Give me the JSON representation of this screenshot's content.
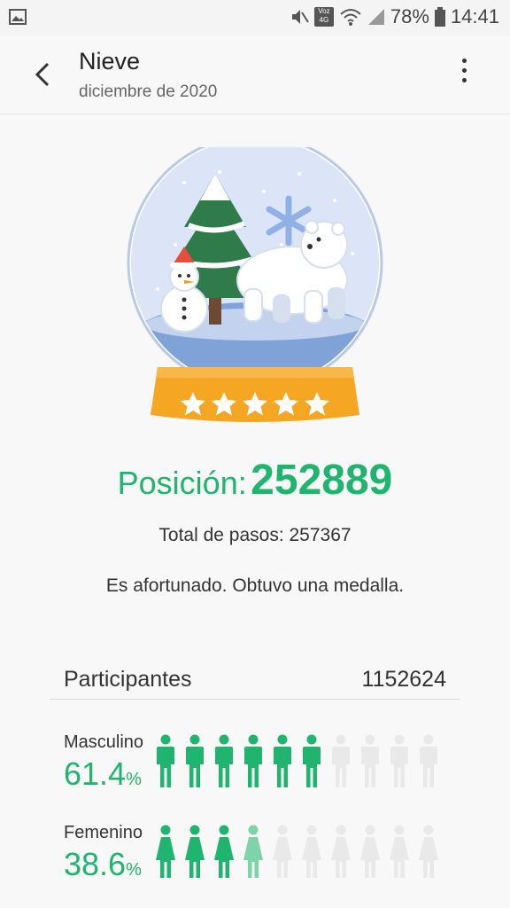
{
  "status_bar": {
    "battery": "78%",
    "time": "14:41",
    "network_badge": "Voz 4G"
  },
  "header": {
    "title": "Nieve",
    "subtitle": "diciembre de 2020"
  },
  "result": {
    "position_label": "Posición:",
    "position_value": "252889",
    "total_steps": "Total de pasos: 257367",
    "message": "Es afortunado. Obtuvo una medalla."
  },
  "participants": {
    "label": "Participantes",
    "value": "1152624"
  },
  "genders": [
    {
      "label": "Masculino",
      "percent": "61.4",
      "percent_sign": "%",
      "share": 0.614
    },
    {
      "label": "Femenino",
      "percent": "38.6",
      "percent_sign": "%",
      "share": 0.386
    }
  ],
  "colors": {
    "accent_green": "#1fb56e",
    "light_green": "#7ed3a8",
    "inactive_figure": "#e9e9e9",
    "medal_orange": "#f5a623"
  },
  "icons": {
    "back": "chevron-left-icon",
    "more": "more-vertical-icon",
    "gallery": "image-icon",
    "mute": "mute-icon",
    "wifi": "wifi-icon",
    "signal": "signal-icon",
    "battery": "battery-icon"
  }
}
